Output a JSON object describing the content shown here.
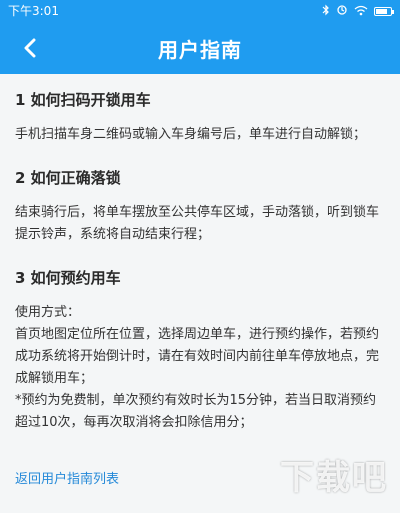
{
  "status_bar": {
    "time": "下午3:01",
    "icons": [
      "bluetooth-icon",
      "sync-icon",
      "wifi-icon",
      "battery-icon"
    ],
    "battery_level": 0.8
  },
  "nav": {
    "title": "用户指南",
    "back_icon": "chevron-left-icon"
  },
  "sections": [
    {
      "title": "1 如何扫码开锁用车",
      "body": "手机扫描车身二维码或输入车身编号后，单车进行自动解锁；"
    },
    {
      "title": "2 如何正确落锁",
      "body": "结束骑行后，将单车摆放至公共停车区域，手动落锁，听到锁车提示铃声，系统将自动结束行程；"
    },
    {
      "title": "3 如何预约用车",
      "body_lines": [
        "使用方式：",
        "首页地图定位所在位置，选择周边单车，进行预约操作，若预约成功系统将开始倒计时，请在有效时间内前往单车停放地点，完成解锁用车；",
        "*预约为免费制，单次预约有效时长为15分钟，若当日取消预约超过10次，每再次取消将会扣除信用分；"
      ]
    }
  ],
  "footer_link": "返回用户指南列表",
  "watermark_text": "下载吧",
  "colors": {
    "header_bg": "#1f9cf0",
    "page_bg": "#f4f6f7",
    "link": "#2489d8"
  }
}
